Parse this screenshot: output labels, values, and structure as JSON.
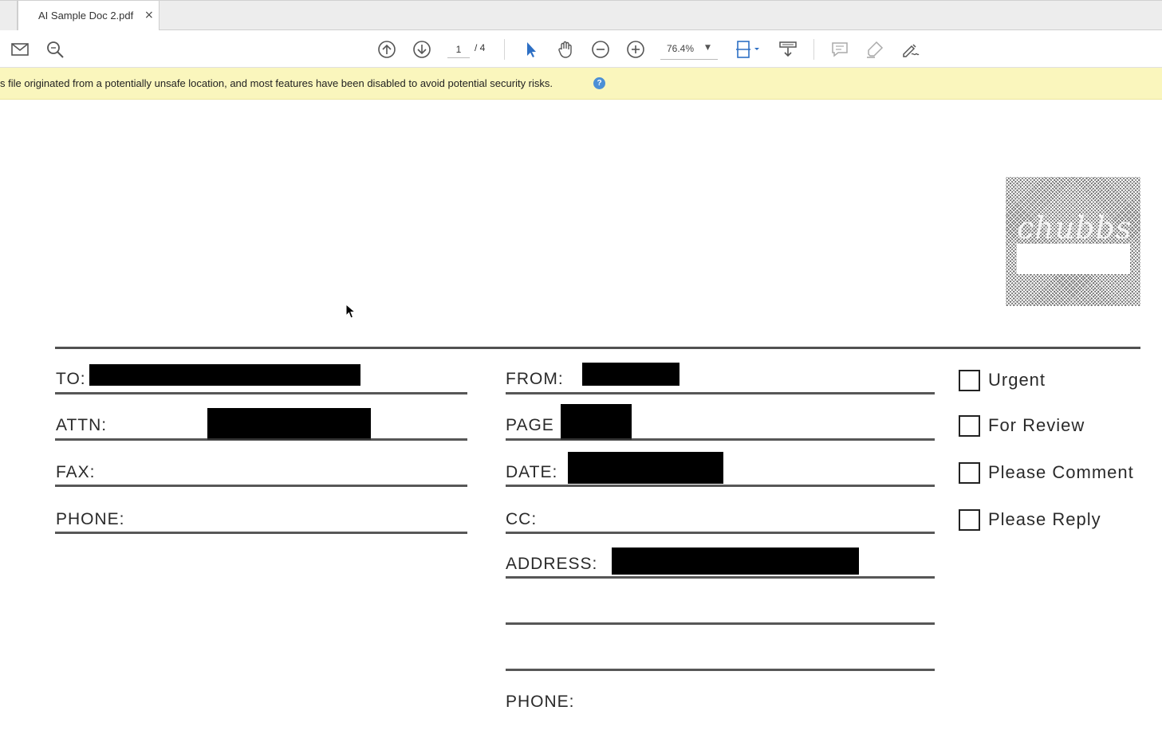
{
  "tab": {
    "title": "AI Sample Doc 2.pdf",
    "close": "×"
  },
  "toolbar": {
    "icons": [
      "mail-icon",
      "search-icon",
      "page-up-icon",
      "page-down-icon",
      "select-arrow-icon",
      "hand-tool-icon",
      "zoom-out-icon",
      "zoom-in-icon",
      "fit-page-icon",
      "scroll-mode-icon",
      "comment-icon",
      "highlight-icon",
      "sign-icon"
    ],
    "page_current": "1",
    "page_total": "/ 4",
    "zoom": "76.4%"
  },
  "security_bar": {
    "message": "s file originated from a potentially unsafe location, and most features have been disabled to avoid potential security risks.",
    "help": "?"
  },
  "document": {
    "logo_text": "chubbs",
    "left_fields": [
      {
        "label": "TO:"
      },
      {
        "label": "ATTN:"
      },
      {
        "label": "FAX:"
      },
      {
        "label": "PHONE:"
      }
    ],
    "right_fields": [
      {
        "label": "FROM:"
      },
      {
        "label": "PAGE"
      },
      {
        "label": "DATE:"
      },
      {
        "label": "CC:"
      },
      {
        "label": "ADDRESS:"
      },
      {
        "label": "PHONE:"
      }
    ],
    "checkboxes": [
      {
        "label": "Urgent",
        "checked": false
      },
      {
        "label": "For Review",
        "checked": false
      },
      {
        "label": "Please Comment",
        "checked": false
      },
      {
        "label": "Please Reply",
        "checked": false
      }
    ]
  }
}
